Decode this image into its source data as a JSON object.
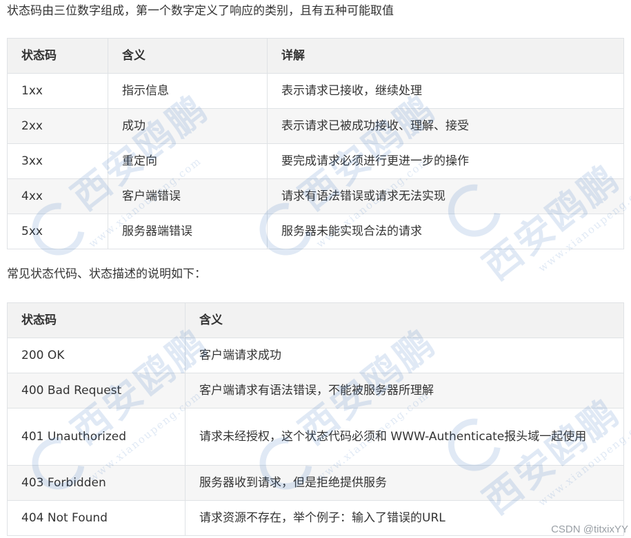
{
  "intro_text": "状态码由三位数字组成，第一个数字定义了响应的类别，且有五种可能取值",
  "table1": {
    "headers": [
      "状态码",
      "含义",
      "详解"
    ],
    "rows": [
      [
        "1xx",
        "指示信息",
        "表示请求已接收，继续处理"
      ],
      [
        "2xx",
        "成功",
        "表示请求已被成功接收、理解、接受"
      ],
      [
        "3xx",
        "重定向",
        "要完成请求必须进行更进一步的操作"
      ],
      [
        "4xx",
        "客户端错误",
        "请求有语法错误或请求无法实现"
      ],
      [
        "5xx",
        "服务器端错误",
        "服务器未能实现合法的请求"
      ]
    ]
  },
  "mid_text": "常见状态代码、状态描述的说明如下：",
  "table2": {
    "headers": [
      "状态码",
      "含义"
    ],
    "rows": [
      [
        "200 OK",
        "客户端请求成功"
      ],
      [
        "400 Bad Request",
        "客户端请求有语法错误，不能被服务器所理解"
      ],
      [
        "401 Unauthorized",
        "请求未经授权，这个状态代码必须和 WWW-Authenticate报头域一起使用"
      ],
      [
        "403 Forbidden",
        "服务器收到请求，但是拒绝提供服务"
      ],
      [
        "404 Not Found",
        "请求资源不存在，举个例子：输入了错误的URL"
      ]
    ]
  },
  "watermark": {
    "text": "西安鸥鹏",
    "url": "www.xianoupeng.com",
    "color": "#1a5fb4"
  },
  "csdn_mark": "CSDN @titxixYY"
}
